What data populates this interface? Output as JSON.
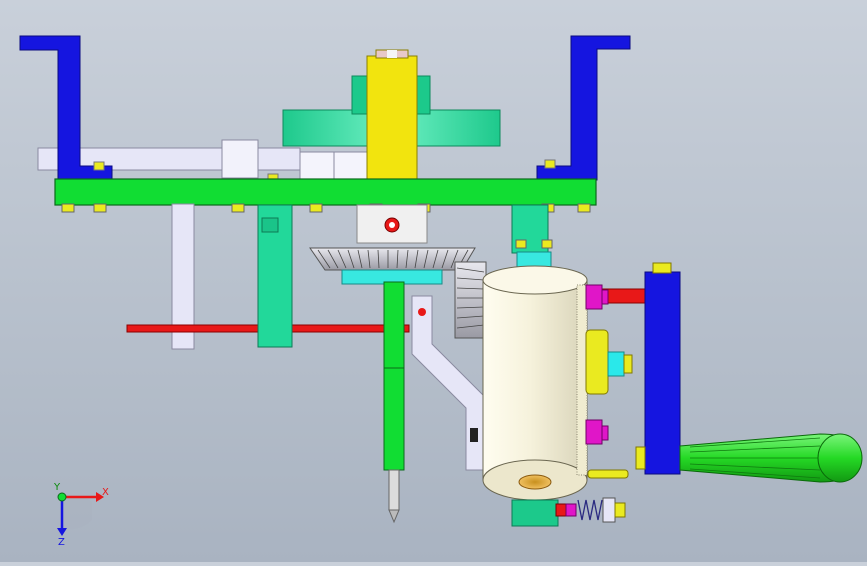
{
  "viewport": {
    "background_top": "#c9d0da",
    "background_bottom": "#a9b3c1"
  },
  "colors": {
    "frame_blue": "#1515e0",
    "base_green": "#11dd33",
    "teal_green": "#22d89a",
    "shaft_yellow": "#f2e40e",
    "bracket_lavender": "#e6e6f7",
    "rod_red": "#e81818",
    "magenta": "#e016c8",
    "cylinder_ivory": "#f6f2dc",
    "handle_green": "#2fe02f",
    "cyan": "#38e8e0",
    "bolt_yellow": "#eaea20"
  },
  "triad": {
    "x_label": "X",
    "y_label": "Y",
    "z_label": "Z"
  }
}
